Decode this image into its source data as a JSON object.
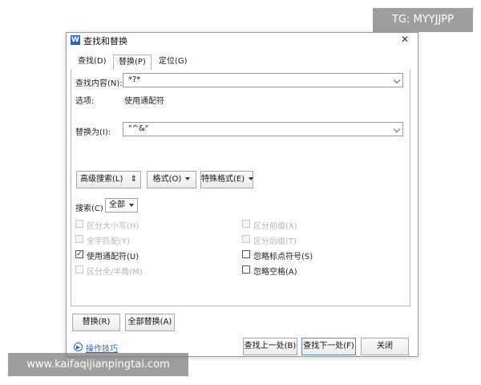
{
  "watermark": {
    "top": "TG: MYYJJPP",
    "bottom": "www.kaifaqijianpingtai.com"
  },
  "dialog": {
    "app_icon": "W",
    "title": "查找和替换",
    "close_glyph": "✕",
    "tabs": [
      {
        "label": "查找(D)"
      },
      {
        "label": "替换(P)"
      },
      {
        "label": "定位(G)"
      }
    ],
    "find_label": "查找内容(N):",
    "find_value": "*?*",
    "options_label": "选项:",
    "options_value": "使用通配符",
    "replace_label": "替换为(I):",
    "replace_value": "\"^&\"",
    "buttons": {
      "advanced": "高级搜索(L)",
      "advanced_arrow": "⇕",
      "format": "格式(O)",
      "special": "特殊格式(E)"
    },
    "search_label": "搜索(C)",
    "search_value": "全部",
    "checkboxes_left": [
      {
        "label": "区分大小写(H)",
        "checked": false,
        "disabled": true
      },
      {
        "label": "全字匹配(Y)",
        "checked": false,
        "disabled": true
      },
      {
        "label": "使用通配符(U)",
        "checked": true,
        "disabled": false
      },
      {
        "label": "区分全/半角(M)",
        "checked": false,
        "disabled": true
      }
    ],
    "checkboxes_right": [
      {
        "label": "区分前缀(X)",
        "checked": false,
        "disabled": true
      },
      {
        "label": "区分后缀(T)",
        "checked": false,
        "disabled": true
      },
      {
        "label": "忽略标点符号(S)",
        "checked": false,
        "disabled": false
      },
      {
        "label": "忽略空格(A)",
        "checked": false,
        "disabled": false
      }
    ],
    "replace_btn": "替换(R)",
    "replace_all_btn": "全部替换(A)",
    "help_link": "操作技巧",
    "find_prev_btn": "查找上一处(B)",
    "find_next_btn": "查找下一处(F)",
    "close_btn": "关闭"
  }
}
